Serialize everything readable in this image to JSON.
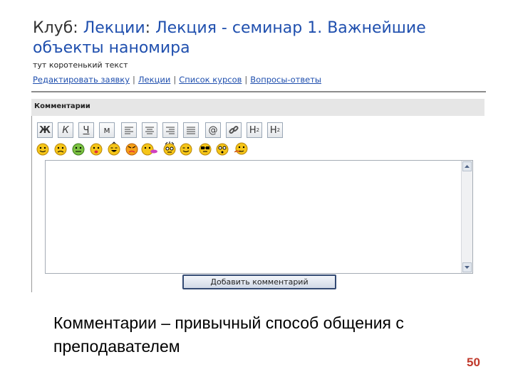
{
  "breadcrumb": {
    "club": "Клуб",
    "sep": ":",
    "lectures": "Лекции",
    "lecture_title": "Лекция - семинар 1. Важнейшие объекты наномира"
  },
  "description": "тут коротенький текст",
  "nav": {
    "links": [
      "Редактировать заявку",
      "Лекции",
      "Список курсов",
      "Вопросы-ответы"
    ],
    "separator": "|"
  },
  "comments": {
    "header": "Комментарии",
    "toolbar": {
      "bold": "Ж",
      "italic": "К",
      "underline": "Ч",
      "mono": "м",
      "email": "@",
      "h2": "H",
      "h2_sub": "2",
      "h2sup": "H",
      "h2sup_sup": "2"
    },
    "submit_label": "Добавить комментарий"
  },
  "slide": {
    "caption": "Комментарии – привычный способ общения с преподавателем",
    "page_number": "50"
  },
  "colors": {
    "link": "#1f4fae",
    "page_number": "#c0392b",
    "smiley": "#f5c518"
  }
}
